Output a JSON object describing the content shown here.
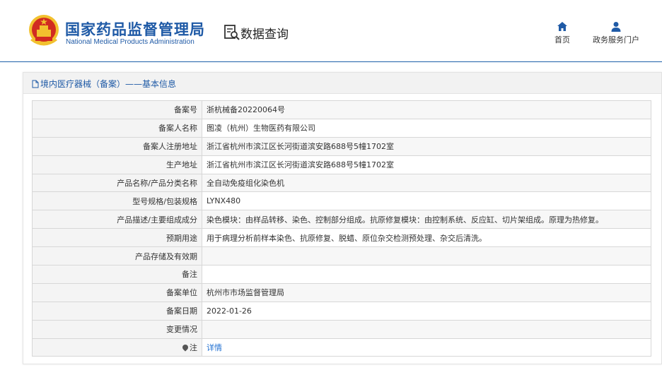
{
  "header": {
    "agency_name_cn": "国家药品监督管理局",
    "agency_name_en": "National Medical Products Administration",
    "section_title": "数据查询",
    "nav": [
      {
        "label": "首页",
        "icon": "home-icon"
      },
      {
        "label": "政务服务门户",
        "icon": "user-icon"
      }
    ]
  },
  "panel": {
    "title": "境内医疗器械（备案）——基本信息",
    "rows": [
      {
        "label": "备案号",
        "value": "浙杭械备20220064号"
      },
      {
        "label": "备案人名称",
        "value": "图凌（杭州）生物医药有限公司"
      },
      {
        "label": "备案人注册地址",
        "value": "浙江省杭州市滨江区长河街道滨安路688号5幢1702室"
      },
      {
        "label": "生产地址",
        "value": "浙江省杭州市滨江区长河街道滨安路688号5幢1702室"
      },
      {
        "label": "产品名称/产品分类名称",
        "value": "全自动免疫组化染色机"
      },
      {
        "label": "型号规格/包装规格",
        "value": "LYNX480"
      },
      {
        "label": "产品描述/主要组成成分",
        "value": "染色模块：由样品转移、染色、控制部分组成。抗原修复模块：由控制系统、反应缸、切片架组成。原理为热修复。"
      },
      {
        "label": "预期用途",
        "value": "用于病理分析前样本染色、抗原修复、脱蜡、原位杂交检测预处理、杂交后清洗。"
      },
      {
        "label": "产品存储及有效期",
        "value": ""
      },
      {
        "label": "备注",
        "value": ""
      },
      {
        "label": "备案单位",
        "value": "杭州市市场监督管理局"
      },
      {
        "label": "备案日期",
        "value": "2022-01-26"
      },
      {
        "label": "变更情况",
        "value": ""
      }
    ],
    "annotation_row": {
      "label": "注",
      "link": "详情"
    }
  },
  "colors": {
    "brand_blue": "#1f5aa6",
    "link_blue": "#1f6fd1",
    "emblem_red": "#d12b21",
    "emblem_gold": "#f2c12e"
  }
}
